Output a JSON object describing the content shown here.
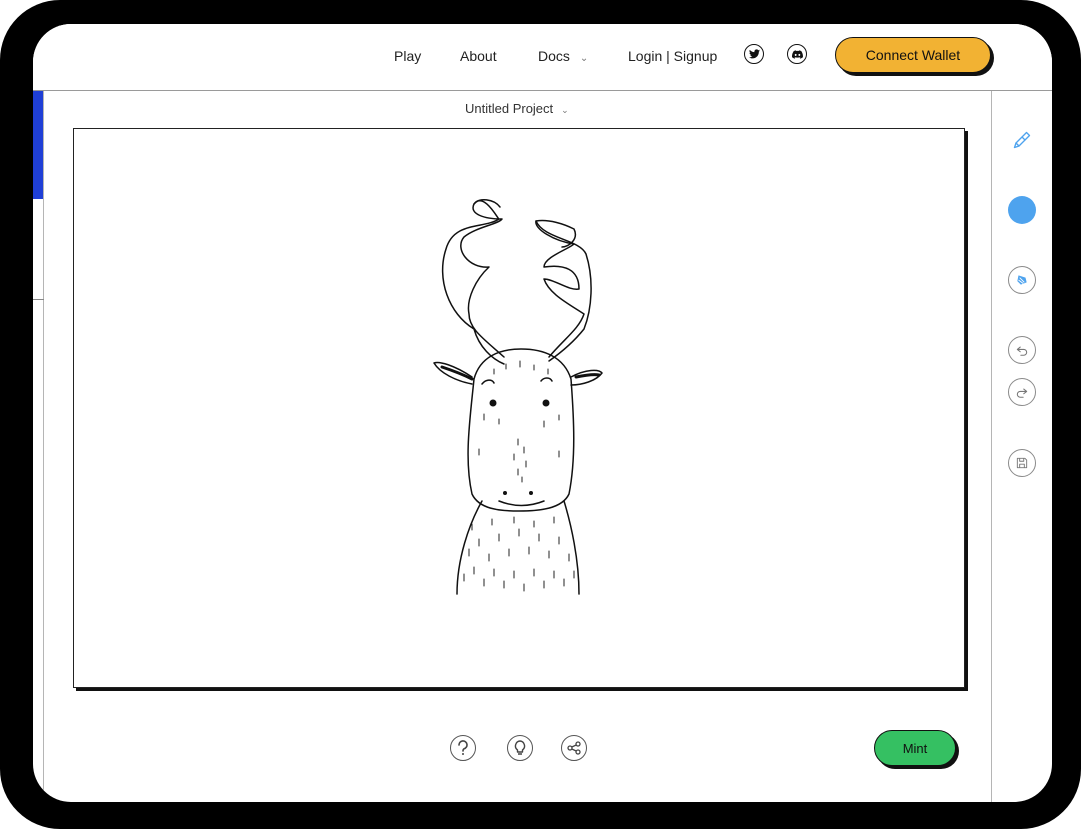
{
  "nav": {
    "play": "Play",
    "about": "About",
    "docs": "Docs",
    "login": "Login | Signup",
    "connect_wallet": "Connect Wallet"
  },
  "social": {
    "twitter": "twitter-icon",
    "discord": "discord-icon"
  },
  "project": {
    "title": "Untitled Project"
  },
  "tools": {
    "brush": "brush-icon",
    "color": "#4ea3ee",
    "fill": "fill-icon",
    "undo": "undo-icon",
    "redo": "redo-icon",
    "save": "save-icon"
  },
  "bottom": {
    "help": "help-icon",
    "idea": "lightbulb-icon",
    "share": "share-icon",
    "mint": "Mint"
  },
  "colors": {
    "accent_blue": "#1f3fd6",
    "wallet_yellow": "#f2b233",
    "mint_green": "#35c062",
    "tool_blue": "#4ea3ee"
  }
}
